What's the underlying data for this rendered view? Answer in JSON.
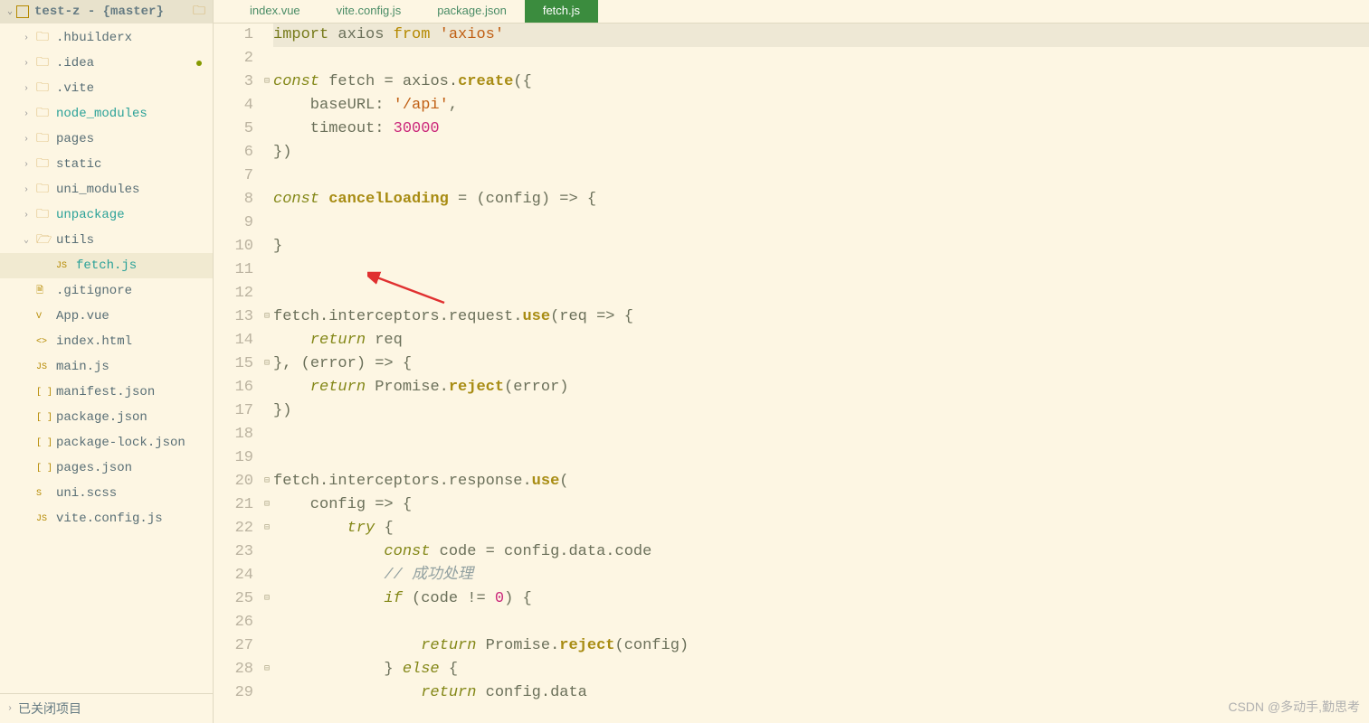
{
  "project": {
    "title": "test-z - {master}"
  },
  "filetree": [
    {
      "label": ".hbuilderx",
      "kind": "folder",
      "indent": 1,
      "chev": "›"
    },
    {
      "label": ".idea",
      "kind": "folder",
      "indent": 1,
      "chev": "›",
      "dot": true
    },
    {
      "label": ".vite",
      "kind": "folder",
      "indent": 1,
      "chev": "›"
    },
    {
      "label": "node_modules",
      "kind": "folder",
      "indent": 1,
      "chev": "›",
      "green": true
    },
    {
      "label": "pages",
      "kind": "folder",
      "indent": 1,
      "chev": "›"
    },
    {
      "label": "static",
      "kind": "folder",
      "indent": 1,
      "chev": "›"
    },
    {
      "label": "uni_modules",
      "kind": "folder",
      "indent": 1,
      "chev": "›"
    },
    {
      "label": "unpackage",
      "kind": "folder",
      "indent": 1,
      "chev": "›",
      "green": true
    },
    {
      "label": "utils",
      "kind": "folder-open",
      "indent": 1,
      "chev": "⌄"
    },
    {
      "label": "fetch.js",
      "kind": "file-js",
      "indent": 2,
      "green": true,
      "selected": true
    },
    {
      "label": ".gitignore",
      "kind": "file",
      "indent": 1
    },
    {
      "label": "App.vue",
      "kind": "file-vue",
      "indent": 1
    },
    {
      "label": "index.html",
      "kind": "file-html",
      "indent": 1
    },
    {
      "label": "main.js",
      "kind": "file-js",
      "indent": 1
    },
    {
      "label": "manifest.json",
      "kind": "file-json",
      "indent": 1
    },
    {
      "label": "package.json",
      "kind": "file-json",
      "indent": 1
    },
    {
      "label": "package-lock.json",
      "kind": "file-json",
      "indent": 1
    },
    {
      "label": "pages.json",
      "kind": "file-json",
      "indent": 1
    },
    {
      "label": "uni.scss",
      "kind": "file-scss",
      "indent": 1
    },
    {
      "label": "vite.config.js",
      "kind": "file-js",
      "indent": 1
    }
  ],
  "footer_panel": "已关闭项目",
  "tabs": [
    {
      "label": "index.vue",
      "active": false
    },
    {
      "label": "vite.config.js",
      "active": false
    },
    {
      "label": "package.json",
      "active": false
    },
    {
      "label": "fetch.js",
      "active": true
    }
  ],
  "code": {
    "lines": [
      {
        "n": 1,
        "fold": "",
        "hl": true,
        "tokens": [
          {
            "c": "kw-import",
            "t": "import"
          },
          {
            "c": "plain",
            "t": " axios "
          },
          {
            "c": "kw-from",
            "t": "from"
          },
          {
            "c": "plain",
            "t": " "
          },
          {
            "c": "str",
            "t": "'axios'"
          }
        ]
      },
      {
        "n": 2,
        "fold": "",
        "tokens": []
      },
      {
        "n": 3,
        "fold": "⊟",
        "tokens": [
          {
            "c": "kw-const",
            "t": "const"
          },
          {
            "c": "plain",
            "t": " fetch "
          },
          {
            "c": "punc",
            "t": "="
          },
          {
            "c": "plain",
            "t": " axios"
          },
          {
            "c": "punc",
            "t": "."
          },
          {
            "c": "func",
            "t": "create"
          },
          {
            "c": "punc",
            "t": "({"
          }
        ]
      },
      {
        "n": 4,
        "fold": "",
        "tokens": [
          {
            "c": "plain",
            "t": "    baseURL: "
          },
          {
            "c": "str",
            "t": "'/api'"
          },
          {
            "c": "punc",
            "t": ","
          }
        ]
      },
      {
        "n": 5,
        "fold": "",
        "tokens": [
          {
            "c": "plain",
            "t": "    timeout: "
          },
          {
            "c": "num",
            "t": "30000"
          }
        ]
      },
      {
        "n": 6,
        "fold": "",
        "tokens": [
          {
            "c": "punc",
            "t": "})"
          }
        ]
      },
      {
        "n": 7,
        "fold": "",
        "tokens": []
      },
      {
        "n": 8,
        "fold": "",
        "tokens": [
          {
            "c": "kw-const",
            "t": "const"
          },
          {
            "c": "plain",
            "t": " "
          },
          {
            "c": "func",
            "t": "cancelLoading"
          },
          {
            "c": "plain",
            "t": " "
          },
          {
            "c": "punc",
            "t": "="
          },
          {
            "c": "plain",
            "t": " "
          },
          {
            "c": "punc",
            "t": "("
          },
          {
            "c": "plain",
            "t": "config"
          },
          {
            "c": "punc",
            "t": ")"
          },
          {
            "c": "plain",
            "t": " "
          },
          {
            "c": "arrow",
            "t": "=>"
          },
          {
            "c": "plain",
            "t": " "
          },
          {
            "c": "punc",
            "t": "{"
          }
        ]
      },
      {
        "n": 9,
        "fold": "",
        "tokens": []
      },
      {
        "n": 10,
        "fold": "",
        "tokens": [
          {
            "c": "punc",
            "t": "}"
          }
        ]
      },
      {
        "n": 11,
        "fold": "",
        "tokens": []
      },
      {
        "n": 12,
        "fold": "",
        "tokens": []
      },
      {
        "n": 13,
        "fold": "⊟",
        "tokens": [
          {
            "c": "plain",
            "t": "fetch"
          },
          {
            "c": "punc",
            "t": "."
          },
          {
            "c": "plain",
            "t": "interceptors"
          },
          {
            "c": "punc",
            "t": "."
          },
          {
            "c": "plain",
            "t": "request"
          },
          {
            "c": "punc",
            "t": "."
          },
          {
            "c": "func",
            "t": "use"
          },
          {
            "c": "punc",
            "t": "("
          },
          {
            "c": "plain",
            "t": "req "
          },
          {
            "c": "arrow",
            "t": "=>"
          },
          {
            "c": "plain",
            "t": " "
          },
          {
            "c": "punc",
            "t": "{"
          }
        ]
      },
      {
        "n": 14,
        "fold": "",
        "tokens": [
          {
            "c": "plain",
            "t": "    "
          },
          {
            "c": "kw-return",
            "t": "return"
          },
          {
            "c": "plain",
            "t": " req"
          }
        ]
      },
      {
        "n": 15,
        "fold": "⊟",
        "tokens": [
          {
            "c": "punc",
            "t": "}, ("
          },
          {
            "c": "plain",
            "t": "error"
          },
          {
            "c": "punc",
            "t": ")"
          },
          {
            "c": "plain",
            "t": " "
          },
          {
            "c": "arrow",
            "t": "=>"
          },
          {
            "c": "plain",
            "t": " "
          },
          {
            "c": "punc",
            "t": "{"
          }
        ]
      },
      {
        "n": 16,
        "fold": "",
        "tokens": [
          {
            "c": "plain",
            "t": "    "
          },
          {
            "c": "kw-return",
            "t": "return"
          },
          {
            "c": "plain",
            "t": " Promise"
          },
          {
            "c": "punc",
            "t": "."
          },
          {
            "c": "func",
            "t": "reject"
          },
          {
            "c": "punc",
            "t": "("
          },
          {
            "c": "plain",
            "t": "error"
          },
          {
            "c": "punc",
            "t": ")"
          }
        ]
      },
      {
        "n": 17,
        "fold": "",
        "tokens": [
          {
            "c": "punc",
            "t": "})"
          }
        ]
      },
      {
        "n": 18,
        "fold": "",
        "tokens": []
      },
      {
        "n": 19,
        "fold": "",
        "tokens": []
      },
      {
        "n": 20,
        "fold": "⊟",
        "tokens": [
          {
            "c": "plain",
            "t": "fetch"
          },
          {
            "c": "punc",
            "t": "."
          },
          {
            "c": "plain",
            "t": "interceptors"
          },
          {
            "c": "punc",
            "t": "."
          },
          {
            "c": "plain",
            "t": "response"
          },
          {
            "c": "punc",
            "t": "."
          },
          {
            "c": "func",
            "t": "use"
          },
          {
            "c": "punc",
            "t": "("
          }
        ]
      },
      {
        "n": 21,
        "fold": "⊟",
        "tokens": [
          {
            "c": "plain",
            "t": "    config "
          },
          {
            "c": "arrow",
            "t": "=>"
          },
          {
            "c": "plain",
            "t": " "
          },
          {
            "c": "punc",
            "t": "{"
          }
        ]
      },
      {
        "n": 22,
        "fold": "⊟",
        "tokens": [
          {
            "c": "plain",
            "t": "        "
          },
          {
            "c": "kw-try",
            "t": "try"
          },
          {
            "c": "plain",
            "t": " "
          },
          {
            "c": "punc",
            "t": "{"
          }
        ]
      },
      {
        "n": 23,
        "fold": "",
        "tokens": [
          {
            "c": "plain",
            "t": "            "
          },
          {
            "c": "kw-const",
            "t": "const"
          },
          {
            "c": "plain",
            "t": " code "
          },
          {
            "c": "punc",
            "t": "="
          },
          {
            "c": "plain",
            "t": " config"
          },
          {
            "c": "punc",
            "t": "."
          },
          {
            "c": "plain",
            "t": "data"
          },
          {
            "c": "punc",
            "t": "."
          },
          {
            "c": "plain",
            "t": "code"
          }
        ]
      },
      {
        "n": 24,
        "fold": "",
        "tokens": [
          {
            "c": "plain",
            "t": "            "
          },
          {
            "c": "comment",
            "t": "// 成功处理"
          }
        ]
      },
      {
        "n": 25,
        "fold": "⊟",
        "tokens": [
          {
            "c": "plain",
            "t": "            "
          },
          {
            "c": "kw-if",
            "t": "if"
          },
          {
            "c": "plain",
            "t": " "
          },
          {
            "c": "punc",
            "t": "("
          },
          {
            "c": "plain",
            "t": "code "
          },
          {
            "c": "punc",
            "t": "!="
          },
          {
            "c": "plain",
            "t": " "
          },
          {
            "c": "num",
            "t": "0"
          },
          {
            "c": "punc",
            "t": ")"
          },
          {
            "c": "plain",
            "t": " "
          },
          {
            "c": "punc",
            "t": "{"
          }
        ]
      },
      {
        "n": 26,
        "fold": "",
        "tokens": []
      },
      {
        "n": 27,
        "fold": "",
        "tokens": [
          {
            "c": "plain",
            "t": "                "
          },
          {
            "c": "kw-return",
            "t": "return"
          },
          {
            "c": "plain",
            "t": " Promise"
          },
          {
            "c": "punc",
            "t": "."
          },
          {
            "c": "func",
            "t": "reject"
          },
          {
            "c": "punc",
            "t": "("
          },
          {
            "c": "plain",
            "t": "config"
          },
          {
            "c": "punc",
            "t": ")"
          }
        ]
      },
      {
        "n": 28,
        "fold": "⊟",
        "tokens": [
          {
            "c": "plain",
            "t": "            "
          },
          {
            "c": "punc",
            "t": "}"
          },
          {
            "c": "plain",
            "t": " "
          },
          {
            "c": "kw-else",
            "t": "else"
          },
          {
            "c": "plain",
            "t": " "
          },
          {
            "c": "punc",
            "t": "{"
          }
        ]
      },
      {
        "n": 29,
        "fold": "",
        "tokens": [
          {
            "c": "plain",
            "t": "                "
          },
          {
            "c": "kw-return",
            "t": "return"
          },
          {
            "c": "plain",
            "t": " config"
          },
          {
            "c": "punc",
            "t": "."
          },
          {
            "c": "plain",
            "t": "data"
          }
        ]
      }
    ]
  },
  "watermark": "CSDN @多动手,勤思考"
}
